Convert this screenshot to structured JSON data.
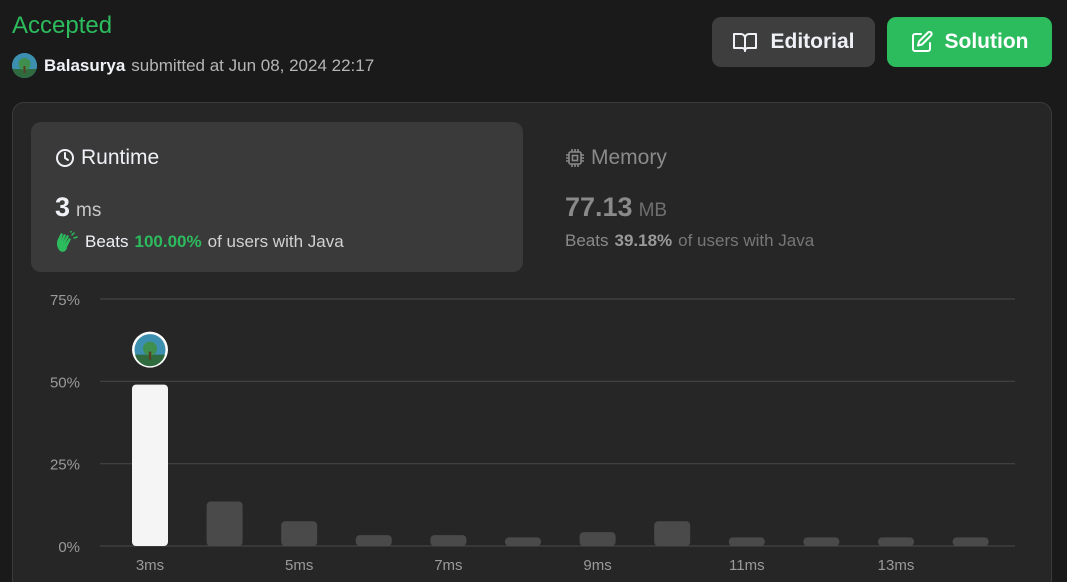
{
  "header": {
    "status": "Accepted",
    "user": "Balasurya",
    "submitted_text": "submitted at Jun 08, 2024 22:17"
  },
  "buttons": {
    "editorial": "Editorial",
    "solution": "Solution"
  },
  "runtime": {
    "label": "Runtime",
    "value": "3",
    "unit": "ms",
    "beats_word": "Beats",
    "beats_pct": "100.00%",
    "beats_rest": "of users with Java"
  },
  "memory": {
    "label": "Memory",
    "value": "77.13",
    "unit": "MB",
    "beats_word": "Beats",
    "beats_pct": "39.18%",
    "beats_rest": "of users with Java"
  },
  "colors": {
    "accent": "#2cbb5d",
    "highlight_bar": "#f5f5f5",
    "bar": "#4a4a4a"
  },
  "chart_data": {
    "type": "bar",
    "categories": [
      "3ms",
      "4ms",
      "5ms",
      "6ms",
      "7ms",
      "8ms",
      "9ms",
      "10ms",
      "11ms",
      "12ms",
      "13ms",
      "14ms"
    ],
    "values": [
      49,
      13.5,
      7.5,
      3.3,
      3.3,
      2.6,
      4.2,
      7.5,
      2.6,
      2.6,
      2.6,
      2.6
    ],
    "y_ticks": [
      "0%",
      "25%",
      "50%",
      "75%"
    ],
    "x_tick_labels": [
      "3ms",
      "",
      "5ms",
      "",
      "7ms",
      "",
      "9ms",
      "",
      "11ms",
      "",
      "13ms",
      ""
    ],
    "ylim": [
      0,
      75
    ],
    "highlight_index": 0,
    "grid": true
  }
}
